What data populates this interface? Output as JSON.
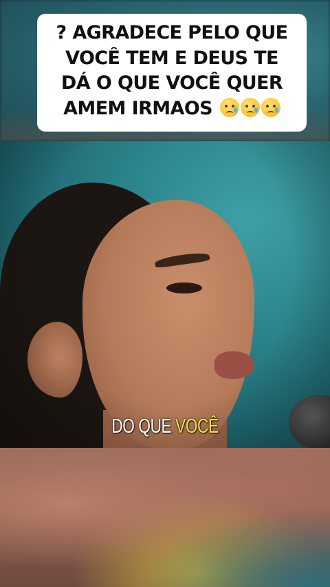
{
  "caption": {
    "lines": [
      "? AGRADECE PELO QUE",
      "VOCÊ TEM E DEUS TE",
      "DÁ O QUE VOCÊ QUER",
      "AMEM IRMAOS"
    ],
    "emoji": [
      "crying-face",
      "crying-face",
      "crying-face"
    ]
  },
  "video": {
    "subtitle_plain": "DO QUE",
    "subtitle_highlight": "VOCÊ",
    "colors": {
      "subtitle_text": "#ffffff",
      "subtitle_highlight": "#f5e23a"
    }
  }
}
